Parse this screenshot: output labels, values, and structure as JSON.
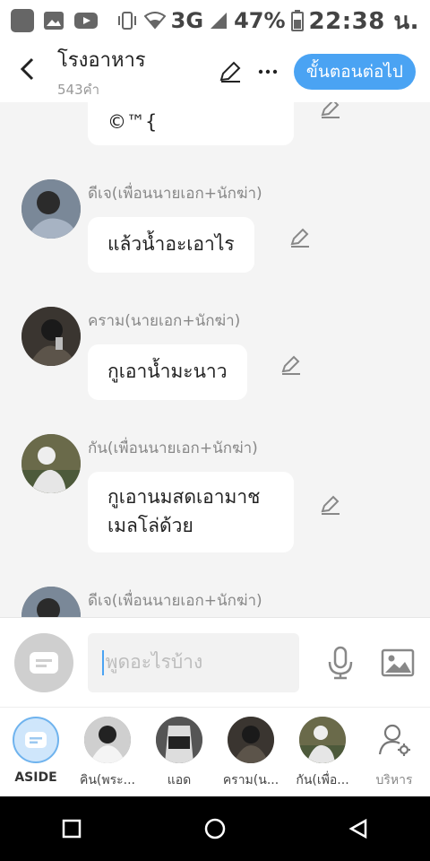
{
  "status_bar": {
    "battery": "47%",
    "network": "3G",
    "time": "22:38 น."
  },
  "header": {
    "title": "โรงอาหาร",
    "word_count": "543คำ",
    "next_label": "ขั้นตอนต่อไป"
  },
  "messages": [
    {
      "sender": "",
      "text": "©™{",
      "partial": true
    },
    {
      "sender": "ดีเจ(เพื่อนนายเอก+นักฆ่า)",
      "text": "แล้วน้ำอะเอาไร"
    },
    {
      "sender": "คราม(นายเอก+นักฆ่า)",
      "text": "กูเอาน้ำมะนาว"
    },
    {
      "sender": "กัน(เพื่อนนายเอก+นักฆ่า)",
      "text": "กูเอานมสดเอามาชเมลโล่ด้วย"
    },
    {
      "sender": "ดีเจ(เพื่อนนายเอก+นักฆ่า)",
      "text": ""
    }
  ],
  "composer": {
    "placeholder": "พูดอะไรบ้าง"
  },
  "characters": [
    {
      "label": "ASIDE"
    },
    {
      "label": "คิน(พระ..."
    },
    {
      "label": "แอด"
    },
    {
      "label": "คราม(น..."
    },
    {
      "label": "กัน(เพื่อ..."
    },
    {
      "label": "บริหาร"
    }
  ],
  "colors": {
    "accent": "#4aa3f3",
    "bubble": "#ffffff",
    "chat_bg": "#f4f4f4"
  }
}
